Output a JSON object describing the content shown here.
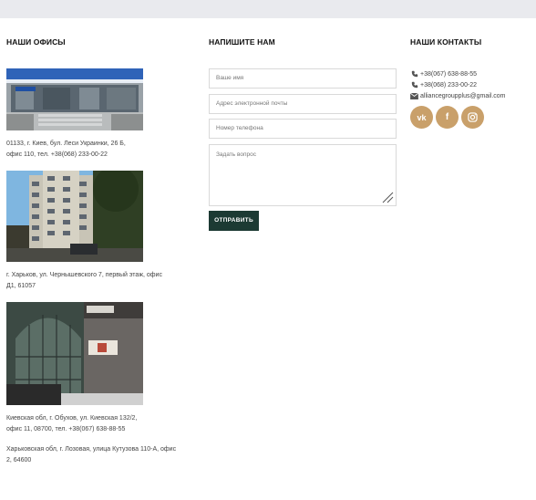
{
  "offices": {
    "heading": "НАШИ ОФИСЫ",
    "items": [
      {
        "address_line1": "01133, г. Киев, бул. Леси Украинки, 26 Б,",
        "address_line2": "офис 110, тел. +38(068) 233-00-22"
      },
      {
        "address_line1": "г. Харьков, ул. Чернышевского 7, первый этаж, офис",
        "address_line2": "Д1, 61057"
      },
      {
        "address_line1": "Киевская обл, г. Обухов, ул. Киевская 132/2,",
        "address_line2": "офис 11, 08700, тел. +38(067) 638-88-55"
      },
      {
        "address_line1": "Харьковская обл, г. Лозовая, улица Кутузова 110-А, офис",
        "address_line2": "2, 64600"
      }
    ]
  },
  "form": {
    "heading": "НАПИШИТЕ НАМ",
    "name_placeholder": "Ваше имя",
    "email_placeholder": "Адрес электронной почты",
    "phone_placeholder": "Номер телефона",
    "question_placeholder": "Задать вопрос",
    "submit_label": "ОТПРАВИТЬ"
  },
  "contacts": {
    "heading": "НАШИ КОНТАКТЫ",
    "phone1": "+38(067) 638-88-55",
    "phone2": "+38(068) 233-00-22",
    "email": "alliancegroupplus@gmail.com",
    "socials": [
      {
        "icon": "vk-icon",
        "glyph": "vk"
      },
      {
        "icon": "facebook-icon",
        "glyph": "f"
      },
      {
        "icon": "instagram-icon",
        "glyph": ""
      }
    ]
  },
  "colors": {
    "accent": "#c9a06a",
    "button": "#1c3a33",
    "topbar": "#e9eaee"
  }
}
